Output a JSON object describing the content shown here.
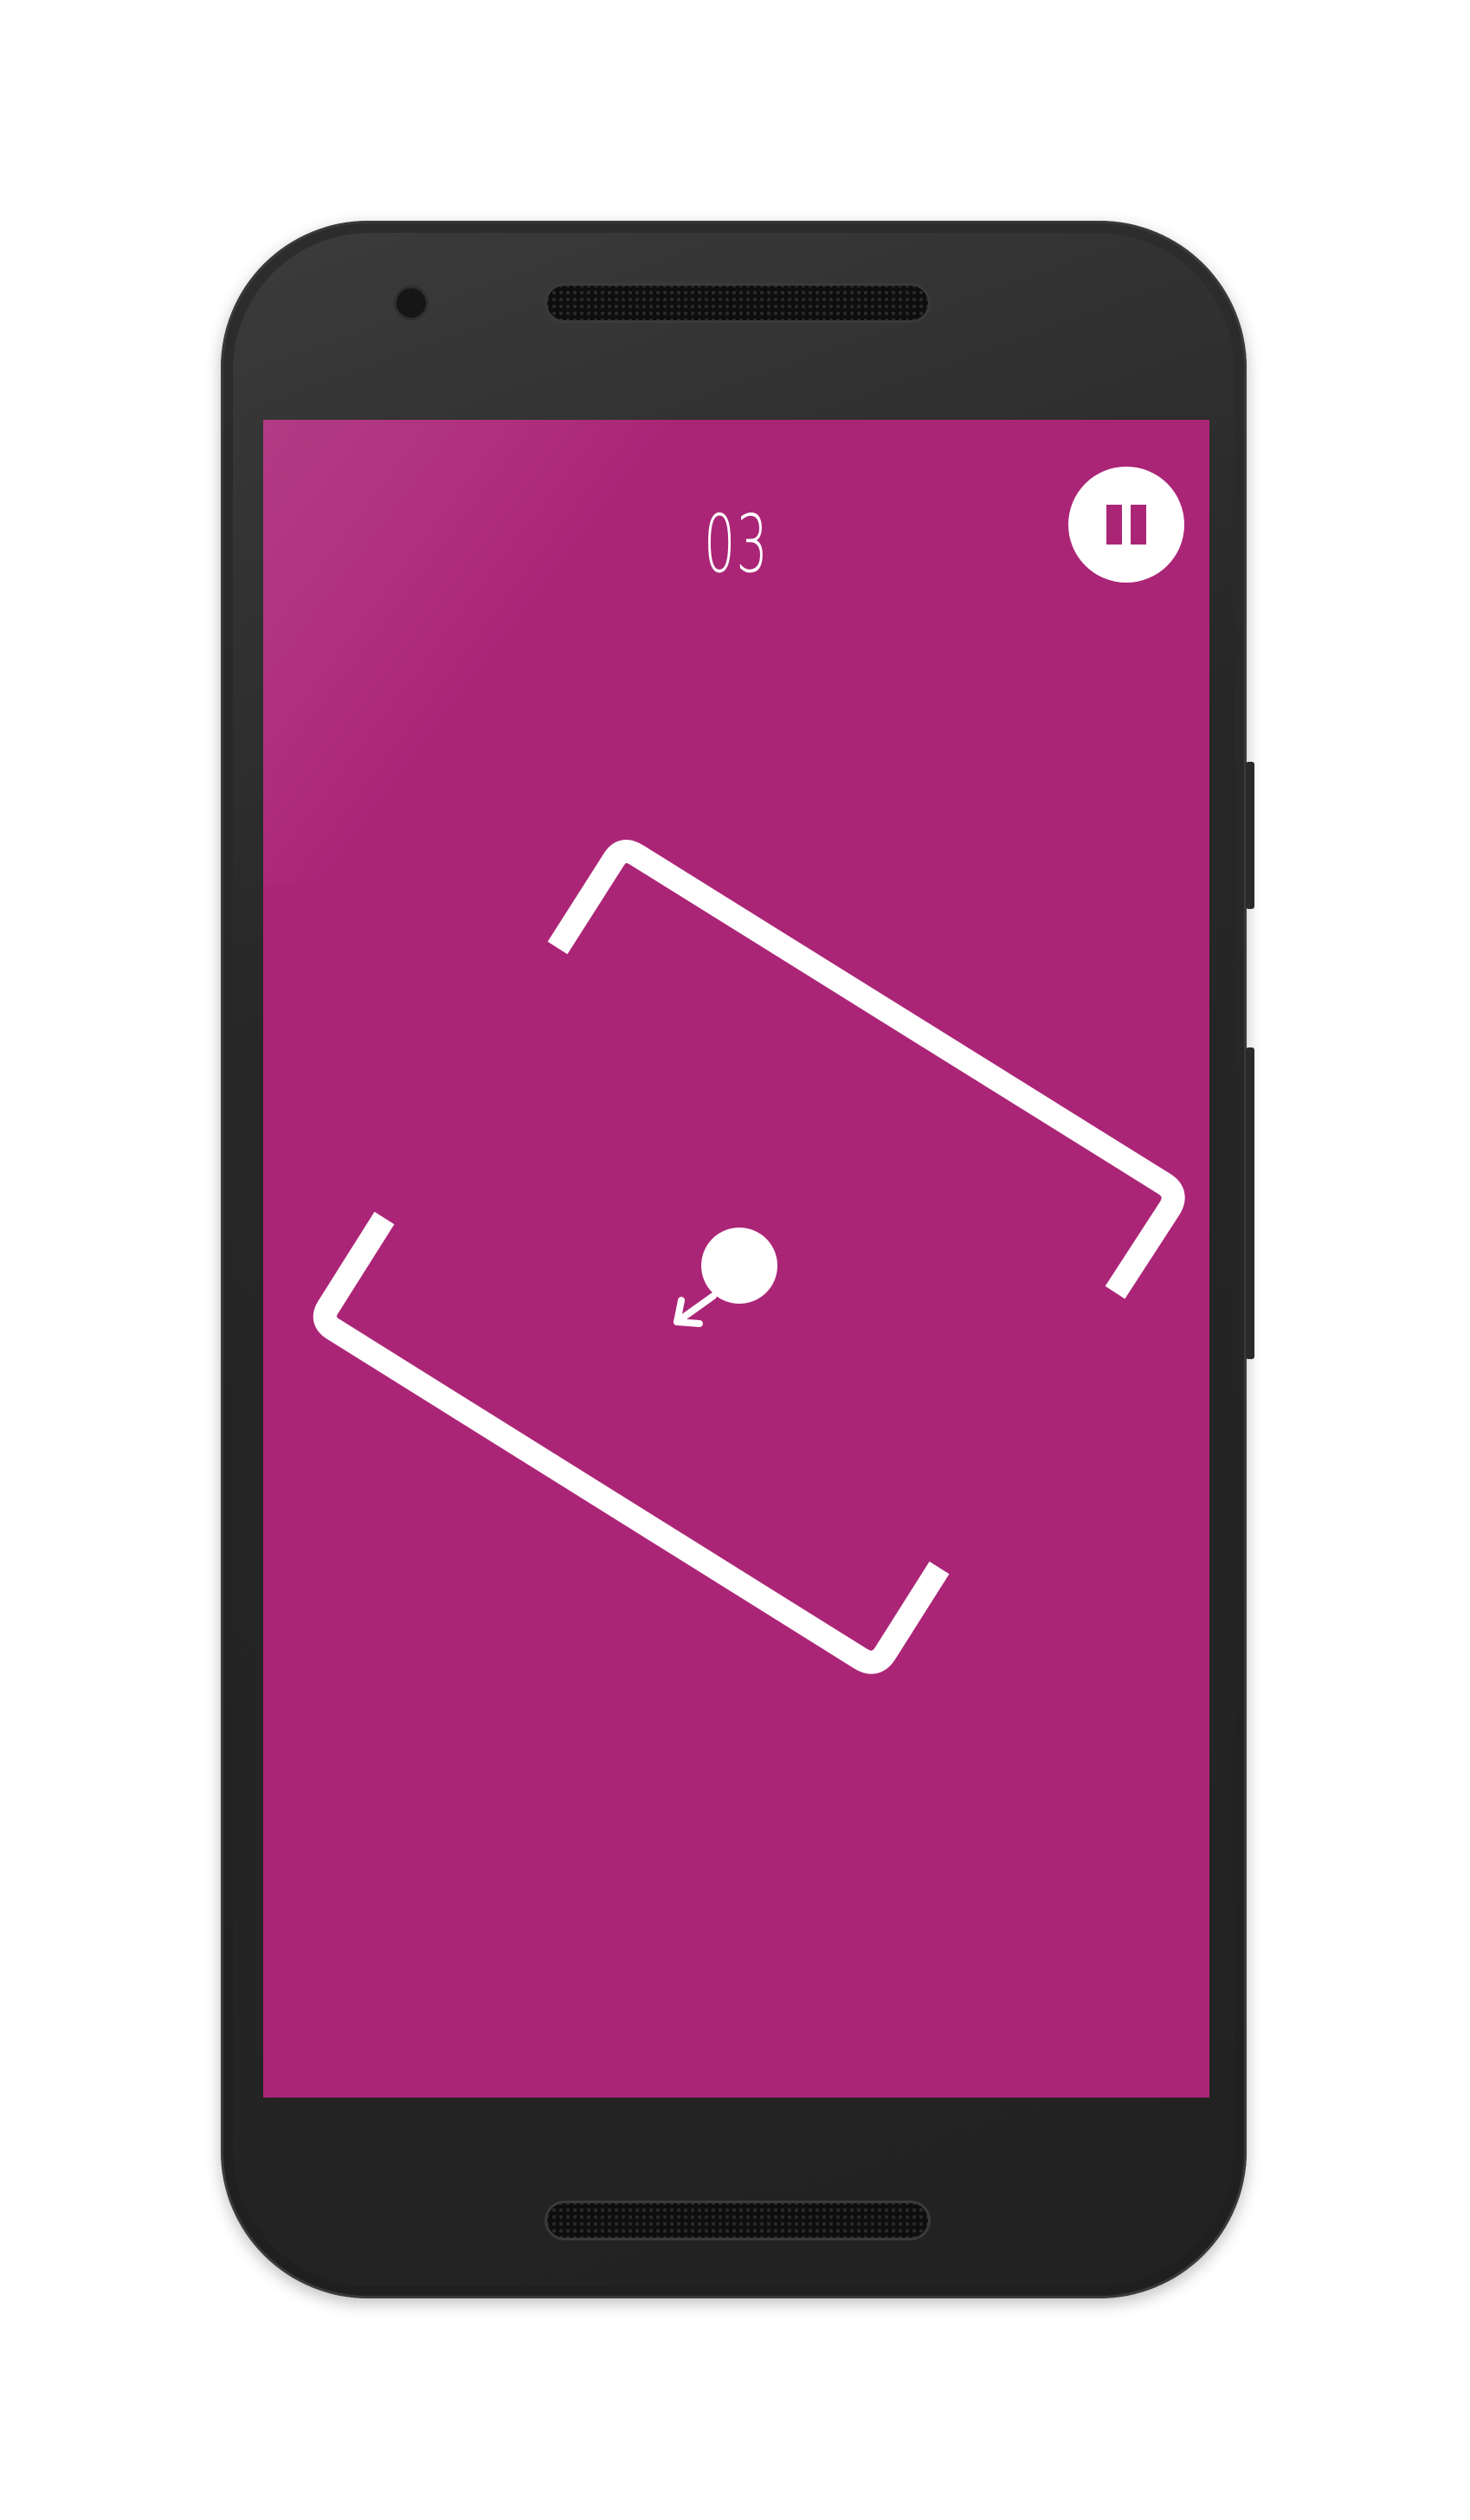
{
  "game": {
    "score": "03",
    "screen_color": "#ab2577",
    "foreground_color": "#ffffff"
  },
  "controls": {
    "pause_icon": "pause-icon"
  }
}
